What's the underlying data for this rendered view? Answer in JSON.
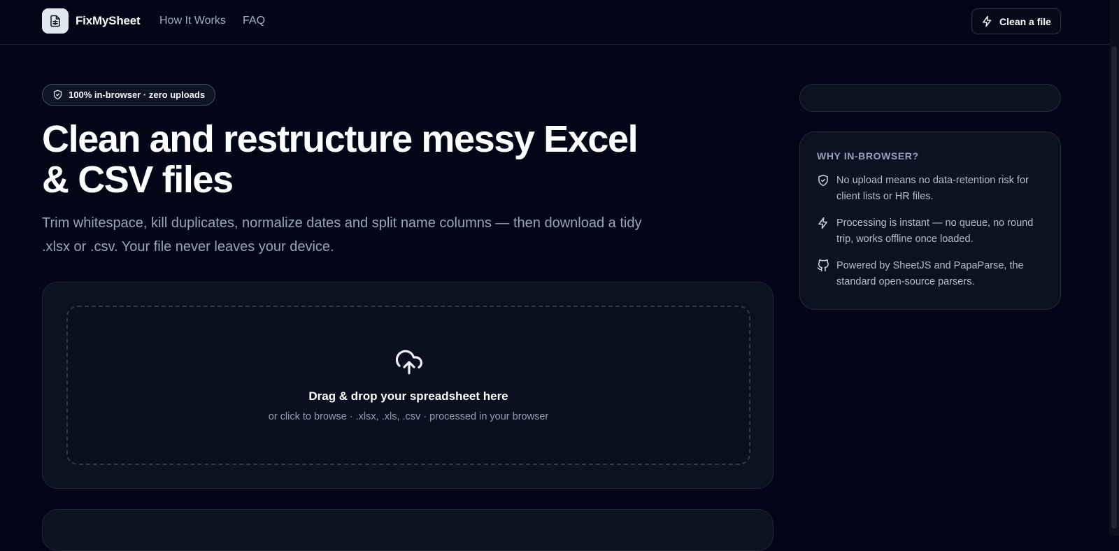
{
  "header": {
    "brand_name": "FixMySheet",
    "nav": [
      {
        "label": "How It Works"
      },
      {
        "label": "FAQ"
      }
    ],
    "cta_label": "Clean a file"
  },
  "hero": {
    "badge": "100% in-browser · zero uploads",
    "title": "Clean and restructure messy Excel & CSV files",
    "subtitle": "Trim whitespace, kill duplicates, normalize dates and split name columns — then download a tidy .xlsx or .csv. Your file never leaves your device."
  },
  "upload": {
    "title": "Drag & drop your spreadsheet here",
    "subtitle": "or click to browse · .xlsx, .xls, .csv · processed in your browser"
  },
  "sidebar": {
    "why_heading": "WHY IN-BROWSER?",
    "items": [
      {
        "icon": "shield-icon",
        "text": "No upload means no data-retention risk for client lists or HR files."
      },
      {
        "icon": "lightning-icon",
        "text": "Processing is instant — no queue, no round trip, works offline once loaded."
      },
      {
        "icon": "github-icon",
        "text": "Powered by SheetJS and PapaParse, the standard open-source parsers."
      }
    ]
  },
  "colors": {
    "background": "#030617",
    "card": "#0c1220",
    "text_muted": "#9aa4b5"
  }
}
